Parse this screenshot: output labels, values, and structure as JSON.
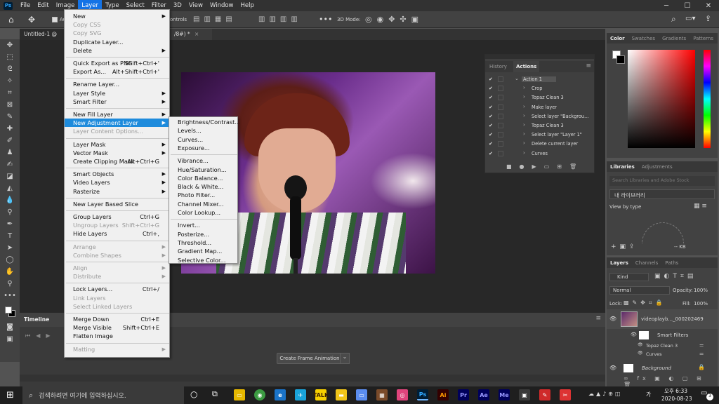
{
  "menubar": {
    "items": [
      "File",
      "Edit",
      "Image",
      "Layer",
      "Type",
      "Select",
      "Filter",
      "3D",
      "View",
      "Window",
      "Help"
    ]
  },
  "optbar": {
    "partial_label": "Au",
    "controls_label": "ontrols",
    "mode3d": "3D Mode:"
  },
  "tabs": {
    "doc1": "Untitled-1 @ 50",
    "doc2": "/8#) *"
  },
  "layer_menu": {
    "items": [
      {
        "label": "New",
        "sc": "",
        "sub": true,
        "dis": false
      },
      {
        "label": "Copy CSS",
        "sc": "",
        "sub": false,
        "dis": true
      },
      {
        "label": "Copy SVG",
        "sc": "",
        "sub": false,
        "dis": true
      },
      {
        "label": "Duplicate Layer...",
        "sc": "",
        "sub": false,
        "dis": false
      },
      {
        "label": "Delete",
        "sc": "",
        "sub": true,
        "dis": false
      },
      {
        "label": "Quick Export as PNG",
        "sc": "Shift+Ctrl+'",
        "sub": false,
        "dis": false
      },
      {
        "label": "Export As...",
        "sc": "Alt+Shift+Ctrl+'",
        "sub": false,
        "dis": false
      },
      {
        "label": "Rename Layer...",
        "sc": "",
        "sub": false,
        "dis": false
      },
      {
        "label": "Layer Style",
        "sc": "",
        "sub": true,
        "dis": false
      },
      {
        "label": "Smart Filter",
        "sc": "",
        "sub": true,
        "dis": false
      },
      {
        "label": "New Fill Layer",
        "sc": "",
        "sub": true,
        "dis": false
      },
      {
        "label": "New Adjustment Layer",
        "sc": "",
        "sub": true,
        "dis": false,
        "hl": true
      },
      {
        "label": "Layer Content Options...",
        "sc": "",
        "sub": false,
        "dis": true
      },
      {
        "label": "Layer Mask",
        "sc": "",
        "sub": true,
        "dis": false
      },
      {
        "label": "Vector Mask",
        "sc": "",
        "sub": true,
        "dis": false
      },
      {
        "label": "Create Clipping Mask",
        "sc": "Alt+Ctrl+G",
        "sub": false,
        "dis": false
      },
      {
        "label": "Smart Objects",
        "sc": "",
        "sub": true,
        "dis": false
      },
      {
        "label": "Video Layers",
        "sc": "",
        "sub": true,
        "dis": false
      },
      {
        "label": "Rasterize",
        "sc": "",
        "sub": true,
        "dis": false
      },
      {
        "label": "New Layer Based Slice",
        "sc": "",
        "sub": false,
        "dis": false
      },
      {
        "label": "Group Layers",
        "sc": "Ctrl+G",
        "sub": false,
        "dis": false
      },
      {
        "label": "Ungroup Layers",
        "sc": "Shift+Ctrl+G",
        "sub": false,
        "dis": true
      },
      {
        "label": "Hide Layers",
        "sc": "Ctrl+,",
        "sub": false,
        "dis": false
      },
      {
        "label": "Arrange",
        "sc": "",
        "sub": true,
        "dis": true
      },
      {
        "label": "Combine Shapes",
        "sc": "",
        "sub": true,
        "dis": true
      },
      {
        "label": "Align",
        "sc": "",
        "sub": true,
        "dis": true
      },
      {
        "label": "Distribute",
        "sc": "",
        "sub": true,
        "dis": true
      },
      {
        "label": "Lock Layers...",
        "sc": "Ctrl+/",
        "sub": false,
        "dis": false
      },
      {
        "label": "Link Layers",
        "sc": "",
        "sub": false,
        "dis": true
      },
      {
        "label": "Select Linked Layers",
        "sc": "",
        "sub": false,
        "dis": true
      },
      {
        "label": "Merge Down",
        "sc": "Ctrl+E",
        "sub": false,
        "dis": false
      },
      {
        "label": "Merge Visible",
        "sc": "Shift+Ctrl+E",
        "sub": false,
        "dis": false
      },
      {
        "label": "Flatten Image",
        "sc": "",
        "sub": false,
        "dis": false
      },
      {
        "label": "Matting",
        "sc": "",
        "sub": true,
        "dis": true
      }
    ]
  },
  "adjust_menu": {
    "items": [
      "Brightness/Contrast...",
      "Levels...",
      "Curves...",
      "Exposure...",
      "Vibrance...",
      "Hue/Saturation...",
      "Color Balance...",
      "Black & White...",
      "Photo Filter...",
      "Channel Mixer...",
      "Color Lookup...",
      "Invert...",
      "Posterize...",
      "Threshold...",
      "Gradient Map...",
      "Selective Color..."
    ]
  },
  "history": {
    "tabs": [
      "History",
      "Actions"
    ],
    "rows": [
      "Action 1",
      "Crop",
      "Topaz Clean 3",
      "Make layer",
      "Select layer \"Backgrou...",
      "Topaz Clean 3",
      "Select layer \"Layer 1\"",
      "Delete current layer",
      "Curves"
    ]
  },
  "color_panel": {
    "tabs": [
      "Color",
      "Swatches",
      "Gradients",
      "Patterns"
    ]
  },
  "libraries": {
    "tabs": [
      "Libraries",
      "Adjustments"
    ],
    "search_placeholder": "Search Libraries and Adobe Stock",
    "library_name": "내 라이브러리",
    "view_by": "View by type",
    "size": "-- KB"
  },
  "layers": {
    "tabs": [
      "Layers",
      "Channels",
      "Paths"
    ],
    "kind": "Kind",
    "blend": "Normal",
    "opacity_label": "Opacity:",
    "opacity": "100%",
    "lock_label": "Lock:",
    "fill_label": "Fill:",
    "fill": "100%",
    "layer1": "videoplayb..._000202469",
    "smart_filters": "Smart Filters",
    "filter1": "Topaz Clean 3",
    "filter2": "Curves",
    "background": "Background"
  },
  "timeline": {
    "title": "Timeline",
    "button": "Create Frame Animation"
  },
  "taskbar": {
    "search": "검색하려면 여기에 입력하십시오.",
    "time": "오후 6:33",
    "date": "2020-08-23",
    "lang": "가",
    "notif": "3"
  }
}
